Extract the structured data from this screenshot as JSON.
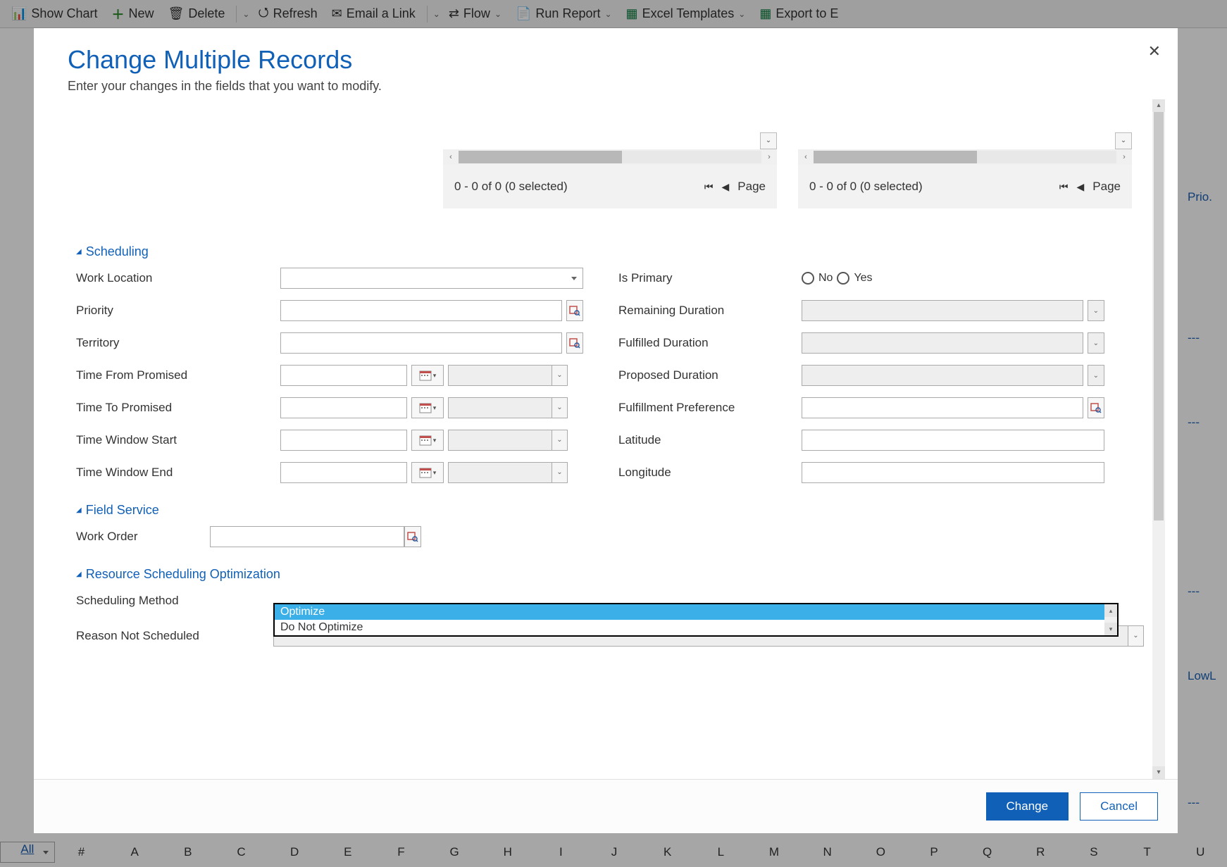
{
  "toolbar": {
    "show_chart": "Show Chart",
    "new": "New",
    "delete": "Delete",
    "refresh": "Refresh",
    "email_link": "Email a Link",
    "flow": "Flow",
    "run_report": "Run Report",
    "excel_templates": "Excel Templates",
    "export_excel": "Export to E"
  },
  "bg": {
    "right1": "Prio.",
    "right2": "LowL",
    "letters": [
      "All",
      "#",
      "A",
      "B",
      "C",
      "D",
      "E",
      "F",
      "G",
      "H",
      "I",
      "J",
      "K",
      "L",
      "M",
      "N",
      "O",
      "P",
      "Q",
      "R",
      "S",
      "T",
      "U"
    ]
  },
  "modal": {
    "title": "Change Multiple Records",
    "subtitle": "Enter your changes in the fields that you want to modify.",
    "close": "✕",
    "change": "Change",
    "cancel": "Cancel"
  },
  "pane": {
    "status": "0 - 0 of 0 (0 selected)",
    "page": "Page"
  },
  "sections": {
    "scheduling": "Scheduling",
    "field_service": "Field Service",
    "rso": "Resource Scheduling Optimization"
  },
  "labels": {
    "work_location": "Work Location",
    "priority": "Priority",
    "territory": "Territory",
    "time_from_promised": "Time From Promised",
    "time_to_promised": "Time To Promised",
    "time_window_start": "Time Window Start",
    "time_window_end": "Time Window End",
    "is_primary": "Is Primary",
    "remaining_duration": "Remaining Duration",
    "fulfilled_duration": "Fulfilled Duration",
    "proposed_duration": "Proposed Duration",
    "fulfillment_preference": "Fulfillment Preference",
    "latitude": "Latitude",
    "longitude": "Longitude",
    "work_order": "Work Order",
    "scheduling_method": "Scheduling Method",
    "reason_not_scheduled": "Reason Not Scheduled"
  },
  "radio": {
    "no": "No",
    "yes": "Yes"
  },
  "dropdown": {
    "optimize": "Optimize",
    "do_not_optimize": "Do Not Optimize"
  }
}
